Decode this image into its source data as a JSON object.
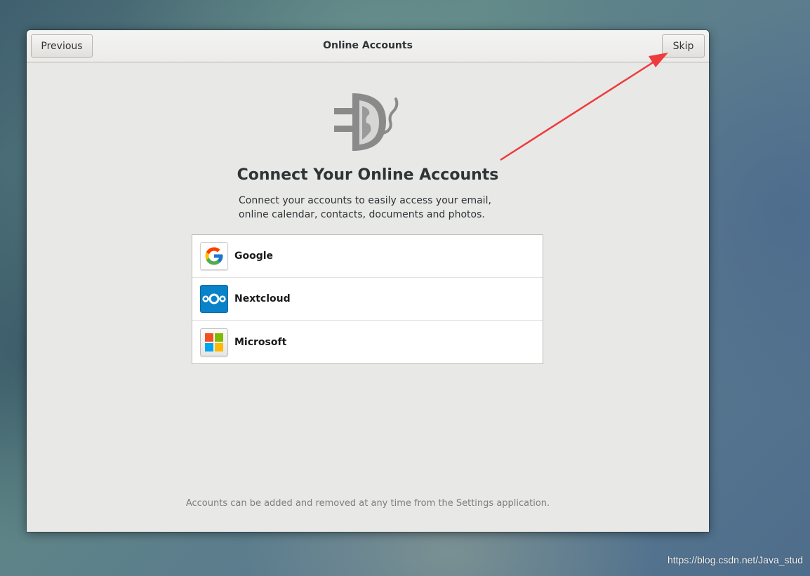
{
  "window": {
    "title": "Online Accounts",
    "previous_label": "Previous",
    "skip_label": "Skip"
  },
  "page": {
    "heading": "Connect Your Online Accounts",
    "description_line1": "Connect your accounts to easily access your email,",
    "description_line2": "online calendar, contacts, documents and photos.",
    "footer": "Accounts can be added and removed at any time from the Settings application."
  },
  "providers": [
    {
      "label": "Google",
      "icon": "google-icon"
    },
    {
      "label": "Nextcloud",
      "icon": "nextcloud-icon"
    },
    {
      "label": "Microsoft",
      "icon": "microsoft-icon"
    }
  ],
  "colors": {
    "annotation_arrow": "#ee3b3b",
    "nextcloud_blue": "#0a82c9",
    "window_bg": "#e8e8e7"
  },
  "watermark": "https://blog.csdn.net/Java_stud"
}
